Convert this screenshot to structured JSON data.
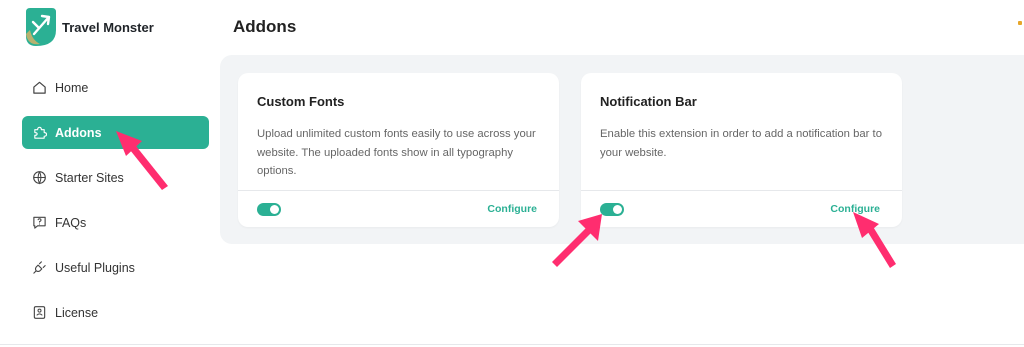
{
  "brand": {
    "name": "Travel Monster"
  },
  "sidebar": {
    "items": [
      {
        "label": "Home",
        "icon": "home-icon"
      },
      {
        "label": "Addons",
        "icon": "puzzle-icon",
        "active": true
      },
      {
        "label": "Starter Sites",
        "icon": "globe-icon"
      },
      {
        "label": "FAQs",
        "icon": "question-icon"
      },
      {
        "label": "Useful Plugins",
        "icon": "plug-icon"
      },
      {
        "label": "License",
        "icon": "id-card-icon"
      }
    ]
  },
  "header": {
    "title": "Addons"
  },
  "addons": [
    {
      "title": "Custom Fonts",
      "description": "Upload unlimited custom fonts easily to use across your website. The uploaded fonts show in all typography options.",
      "enabled": true,
      "action_label": "Configure"
    },
    {
      "title": "Notification Bar",
      "description": "Enable this extension in order to add a notification bar to your website.",
      "enabled": true,
      "action_label": "Configure"
    }
  ],
  "colors": {
    "accent": "#2bb094",
    "arrow": "#ff2d6f",
    "panel_bg": "#f2f4f6"
  }
}
